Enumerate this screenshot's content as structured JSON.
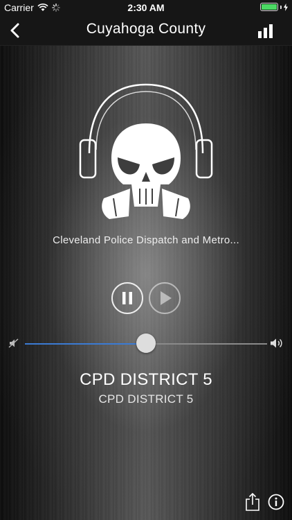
{
  "status_bar": {
    "carrier": "Carrier",
    "time": "2:30 AM",
    "battery_level": 1.0,
    "battery_color": "#4cd964"
  },
  "nav": {
    "title": "Cuyahoga County",
    "back_icon": "chevron-left-icon",
    "stats_icon": "bar-chart-icon"
  },
  "player": {
    "logo_icon": "skull-headphones-logo",
    "station_name": "Cleveland Police Dispatch and Metro...",
    "pause_icon": "pause-icon",
    "play_icon": "play-icon",
    "volume_level": 0.5,
    "volume_color": "#3b7bd4",
    "track_title": "CPD DISTRICT 5",
    "track_subtitle": "CPD DISTRICT 5"
  },
  "toolbar": {
    "share_icon": "share-icon",
    "info_icon": "info-icon"
  }
}
